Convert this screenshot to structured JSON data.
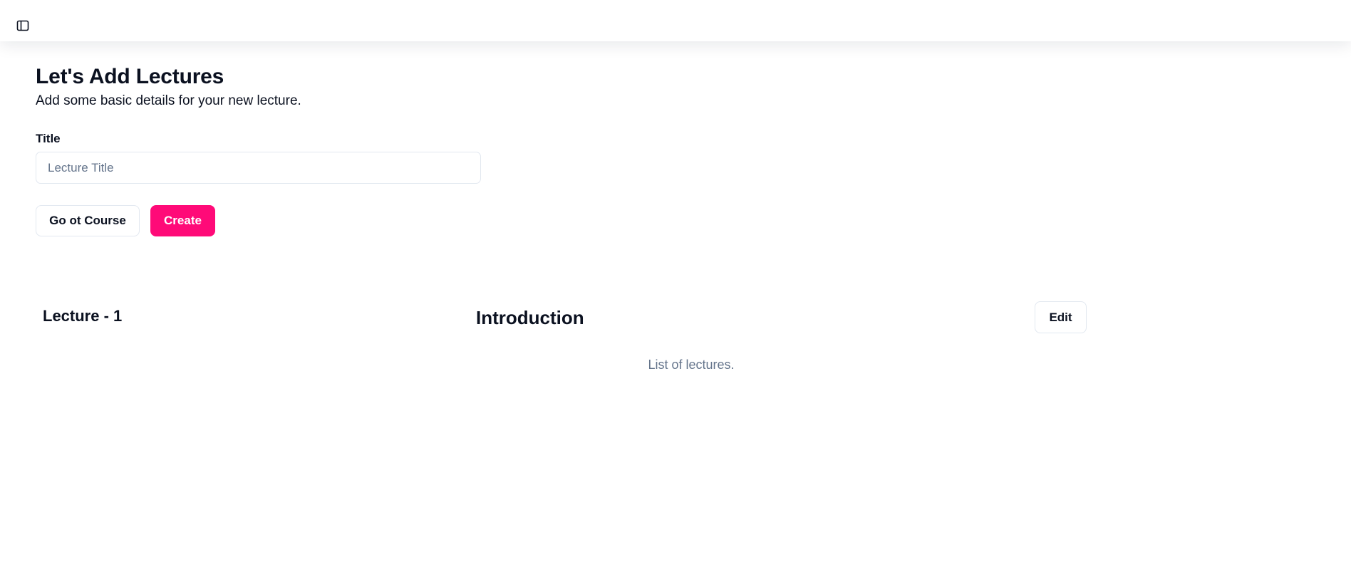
{
  "header": {
    "sidebar_toggle_icon": "panel-left-icon"
  },
  "main": {
    "title": "Let's Add Lectures",
    "subtitle": "Add some basic details for your new lecture.",
    "form": {
      "title_label": "Title",
      "title_value": "",
      "title_placeholder": "Lecture Title"
    },
    "actions": {
      "back_label": "Go ot Course",
      "create_label": "Create"
    },
    "accent_color": "#ff0a78"
  },
  "lectures": {
    "items": [
      {
        "number": "Lecture - 1",
        "name": "Introduction",
        "edit_label": "Edit"
      }
    ],
    "caption": "List of lectures."
  }
}
